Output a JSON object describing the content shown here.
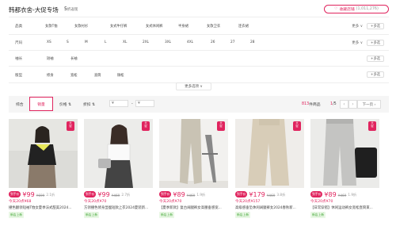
{
  "shop": {
    "title": "韩都衣舍-大促专场",
    "meta": "5",
    "meta_rate": "折返现"
  },
  "follow": {
    "label": "收藏店铺",
    "count": "(1,011,276)"
  },
  "filters": [
    {
      "label": "品类",
      "options": [
        "女款T恤",
        "女款衬衫",
        "女式牛仔裤",
        "女式休闲裤",
        "半身裙",
        "女款卫衣",
        "连衣裙"
      ],
      "more": "更多",
      "multi": "+多选"
    },
    {
      "label": "尺码",
      "options": [
        "XS",
        "S",
        "M",
        "L",
        "XL",
        "2XL",
        "3XL",
        "4XL",
        "26",
        "27",
        "28"
      ],
      "more": "更多",
      "multi": "+多选"
    },
    {
      "label": "袖长",
      "options": [
        "短袖",
        "长袖"
      ],
      "more": "",
      "multi": "+多选"
    },
    {
      "label": "版型",
      "options": [
        "修身",
        "宽松",
        "直筒",
        "微松"
      ],
      "more": "",
      "multi": "+多选"
    }
  ],
  "more_options": "更多选项 ∨",
  "sortbar": {
    "overall": "综合",
    "sales": "销量",
    "price": "价格 ⇅",
    "discount": "折扣 ⇅",
    "price_from": "¥",
    "price_dash": "-",
    "price_to": "¥",
    "count_num": "813",
    "count_label": "件商品",
    "page_current": "1",
    "page_total": "/5",
    "prev": "‹",
    "next": "›",
    "next_page": "下一页 ›"
  },
  "products": [
    {
      "tag": "到手价",
      "price": "¥99",
      "orig": "¥699",
      "sold": "2.1折",
      "promo": "今天20点¥68",
      "name": "撞色翻领短袖T恤女夏季法式甜美2024...",
      "new": "新店上新"
    },
    {
      "tag": "到手价",
      "price": "¥99",
      "orig": "¥469",
      "sold": "2.7折",
      "promo": "今天20点¥70",
      "name": "方领撞色修身显瘦短款上衣2024夏装新...",
      "new": "新店上新"
    },
    {
      "tag": "到手价",
      "price": "¥89",
      "orig": "¥469",
      "sold": "1.9折",
      "promo": "今天20点¥70",
      "name": "【夏季新款】复古阔腿裤女高腰垂感宽...",
      "new": "新店上新"
    },
    {
      "tag": "到手价",
      "price": "¥179",
      "orig": "¥469",
      "sold": "3.8折",
      "promo": "今天20点¥157",
      "name": "高级感垂坠休闲阔腿裤女2024春秋新...",
      "new": "新店上新"
    },
    {
      "tag": "到手价",
      "price": "¥89",
      "orig": "¥469",
      "sold": "1.9折",
      "promo": "今天20点¥70",
      "name": "【日常穿搭】休闲运动裤女宽松直筒束...",
      "new": "新店上新"
    }
  ],
  "colors": {
    "accent": "#e0245e",
    "new_bg": "#e8f7e4",
    "new_fg": "#47a83b"
  }
}
